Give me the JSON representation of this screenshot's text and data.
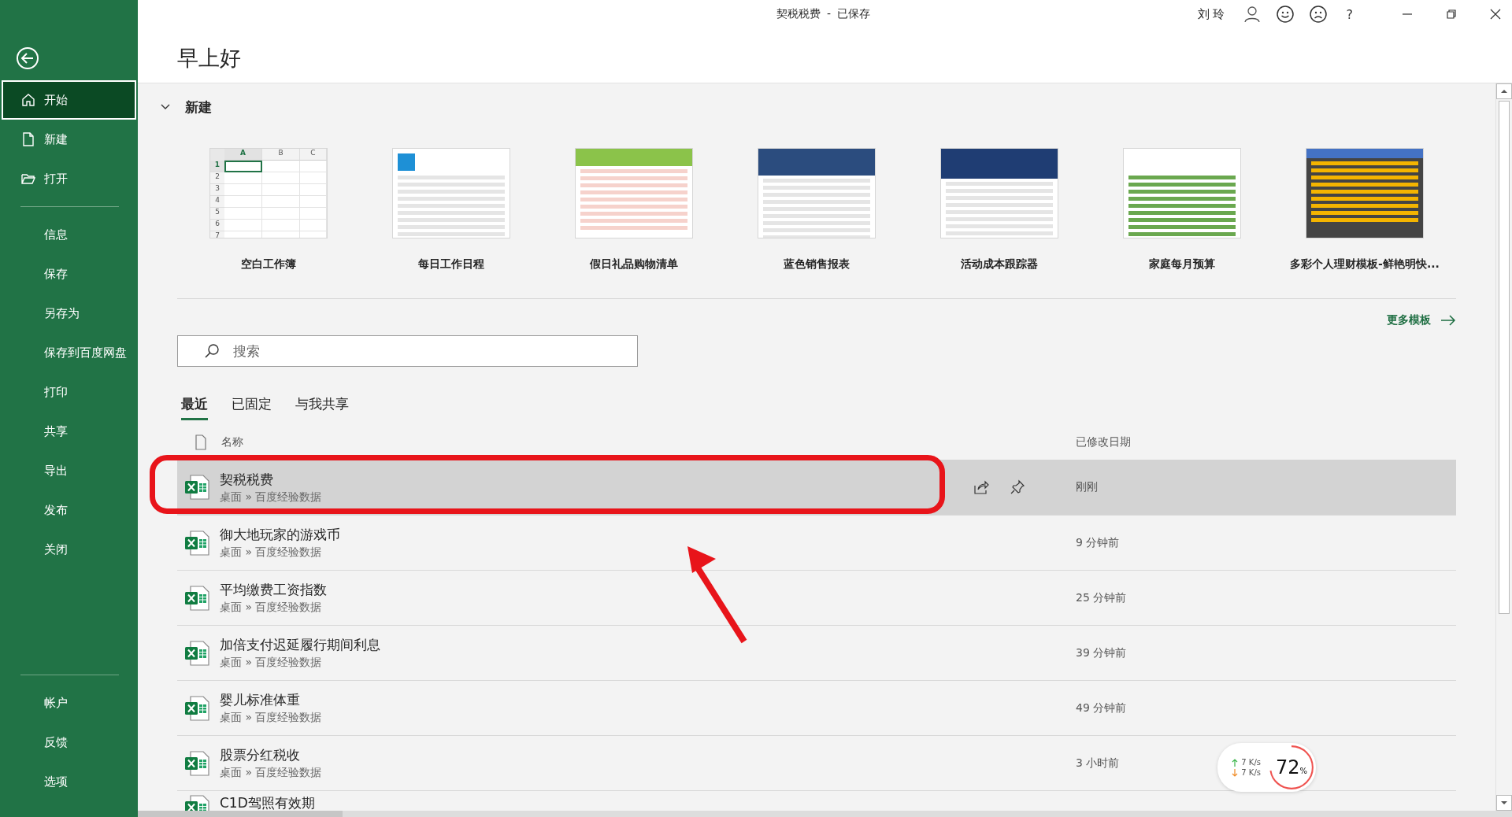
{
  "window": {
    "title": "契税税费",
    "separator": "-",
    "save_state": "已保存",
    "user": "刘 玲",
    "help": "?"
  },
  "sidebar": {
    "items": [
      {
        "label": "开始",
        "kind": "home",
        "selected": true
      },
      {
        "label": "新建",
        "kind": "new",
        "selected": false
      },
      {
        "label": "打开",
        "kind": "open",
        "selected": false
      },
      {
        "label": "信息",
        "kind": "plain",
        "selected": false,
        "divider_before": true
      },
      {
        "label": "保存",
        "kind": "plain",
        "selected": false
      },
      {
        "label": "另存为",
        "kind": "plain",
        "selected": false
      },
      {
        "label": "保存到百度网盘",
        "kind": "plain",
        "selected": false
      },
      {
        "label": "打印",
        "kind": "plain",
        "selected": false
      },
      {
        "label": "共享",
        "kind": "plain",
        "selected": false
      },
      {
        "label": "导出",
        "kind": "plain",
        "selected": false
      },
      {
        "label": "发布",
        "kind": "plain",
        "selected": false
      },
      {
        "label": "关闭",
        "kind": "plain",
        "selected": false
      }
    ],
    "bottom_items": [
      {
        "label": "帐户",
        "selected": false
      },
      {
        "label": "反馈",
        "selected": false
      },
      {
        "label": "选项",
        "selected": false
      }
    ]
  },
  "greeting": "早上好",
  "new_section": {
    "title": "新建",
    "expanded": true,
    "templates": [
      {
        "label": "空白工作簿",
        "kind": "blank",
        "columns": [
          "A",
          "B",
          "C"
        ],
        "rows": [
          "1",
          "2",
          "3",
          "4",
          "5",
          "6",
          "7"
        ]
      },
      {
        "label": "每日工作日程",
        "kind": "schedule"
      },
      {
        "label": "假日礼品购物清单",
        "kind": "shopping"
      },
      {
        "label": "蓝色销售报表",
        "kind": "sales"
      },
      {
        "label": "活动成本跟踪器",
        "kind": "cost"
      },
      {
        "label": "家庭每月预算",
        "kind": "budget"
      },
      {
        "label": "多彩个人理财模板-鲜艳明快...",
        "kind": "finance"
      }
    ],
    "more": "更多模板"
  },
  "search": {
    "placeholder": "搜索"
  },
  "tabs": [
    {
      "label": "最近",
      "selected": true
    },
    {
      "label": "已固定",
      "selected": false
    },
    {
      "label": "与我共享",
      "selected": false
    }
  ],
  "table": {
    "columns": [
      "名称",
      "已修改日期"
    ],
    "rows": [
      {
        "name": "契税税费",
        "path": "桌面 » 百度经验数据",
        "modified": "刚刚",
        "selected": true
      },
      {
        "name": "御大地玩家的游戏币",
        "path": "桌面 » 百度经验数据",
        "modified": "9 分钟前",
        "selected": false
      },
      {
        "name": "平均缴费工资指数",
        "path": "桌面 » 百度经验数据",
        "modified": "25 分钟前",
        "selected": false
      },
      {
        "name": "加倍支付迟延履行期间利息",
        "path": "桌面 » 百度经验数据",
        "modified": "39 分钟前",
        "selected": false
      },
      {
        "name": "婴儿标准体重",
        "path": "桌面 » 百度经验数据",
        "modified": "49 分钟前",
        "selected": false
      },
      {
        "name": "股票分红税收",
        "path": "桌面 » 百度经验数据",
        "modified": "3 小时前",
        "selected": false
      },
      {
        "name": "C1D驾照有效期",
        "selected": false
      }
    ]
  },
  "net_widget": {
    "upload": "7 K/s",
    "download": "7 K/s",
    "percent": "72",
    "unit": "%",
    "level": 0.72
  }
}
